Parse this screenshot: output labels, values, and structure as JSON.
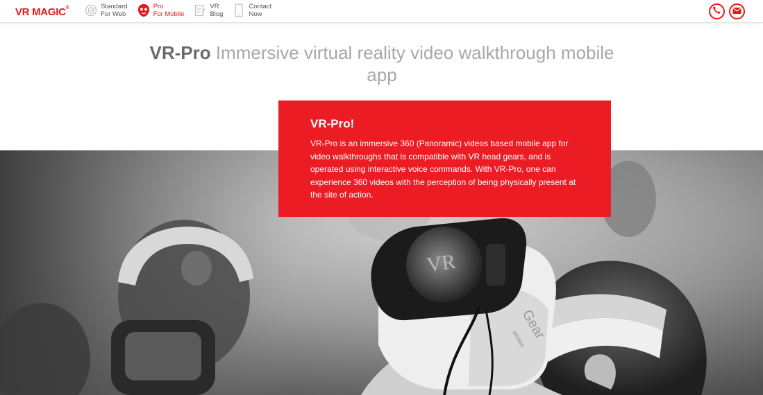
{
  "brand": {
    "name": "VR MAGIC",
    "mark": "®",
    "accent": "#e3191b"
  },
  "nav": [
    {
      "line1": "Standard",
      "line2": "For Web",
      "icon": "panorama-icon",
      "active": false
    },
    {
      "line1": "Pro",
      "line2": "For Mobile",
      "icon": "mask-icon",
      "active": true
    },
    {
      "line1": "VR",
      "line2": "Blog",
      "icon": "document-icon",
      "active": false
    },
    {
      "line1": "Contact",
      "line2": "Now",
      "icon": "phone-device-icon",
      "active": false
    }
  ],
  "header_actions": {
    "phone_icon": "phone-icon",
    "mail_icon": "mail-icon"
  },
  "hero": {
    "title_strong": "VR-Pro",
    "title_rest": " Immersive virtual reality video walkthrough mobile app"
  },
  "card": {
    "title": "VR-Pro!",
    "body": "VR-Pro is an immersive 360 (Panoramic) videos based mobile app for video walkthroughs that is compatible with VR head gears, and is operated using interactive voice commands. With VR-Pro, one can experience 360 videos with the perception of being physically present at the site of action.",
    "color": "#ec1c24"
  },
  "photo": {
    "headset_text_1": "Gear",
    "headset_text_2": "oculus",
    "screen_text": "VR"
  }
}
